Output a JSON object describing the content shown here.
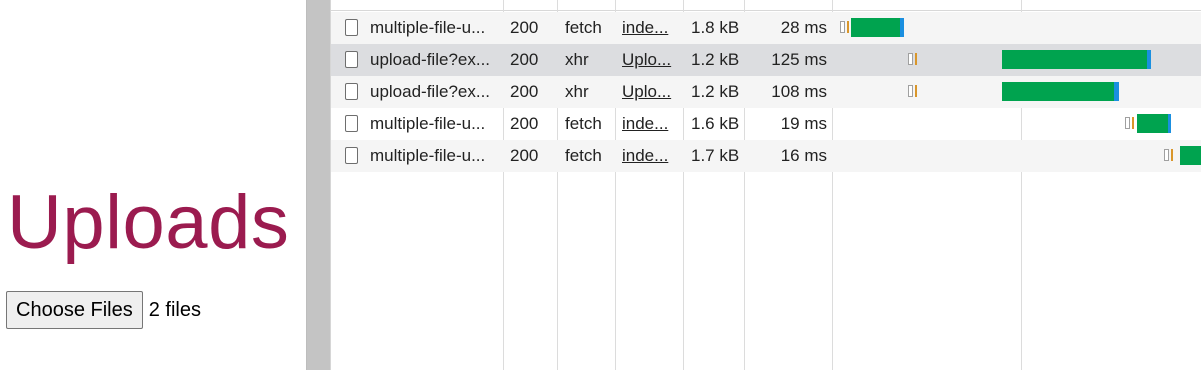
{
  "page": {
    "heading": "Uploads",
    "choose_button": "Choose Files",
    "file_count": "2 files"
  },
  "network": {
    "rows": [
      {
        "name": "multiple-file-u...",
        "status": "200",
        "type": "fetch",
        "initiator": "inde...",
        "size": "1.8 kB",
        "time": "28 ms"
      },
      {
        "name": "upload-file?ex...",
        "status": "200",
        "type": "xhr",
        "initiator": "Uplo...",
        "size": "1.2 kB",
        "time": "125 ms"
      },
      {
        "name": "upload-file?ex...",
        "status": "200",
        "type": "xhr",
        "initiator": "Uplo...",
        "size": "1.2 kB",
        "time": "108 ms"
      },
      {
        "name": "multiple-file-u...",
        "status": "200",
        "type": "fetch",
        "initiator": "inde...",
        "size": "1.6 kB",
        "time": "19 ms"
      },
      {
        "name": "multiple-file-u...",
        "status": "200",
        "type": "fetch",
        "initiator": "inde...",
        "size": "1.7 kB",
        "time": "16 ms"
      }
    ]
  },
  "colors": {
    "heading": "#9b1b4f",
    "waiting_ttfb": "#00a34f",
    "content_download": "#1a8fe0",
    "stalled": "#d9962b",
    "selected_row": "#dcdde0"
  }
}
